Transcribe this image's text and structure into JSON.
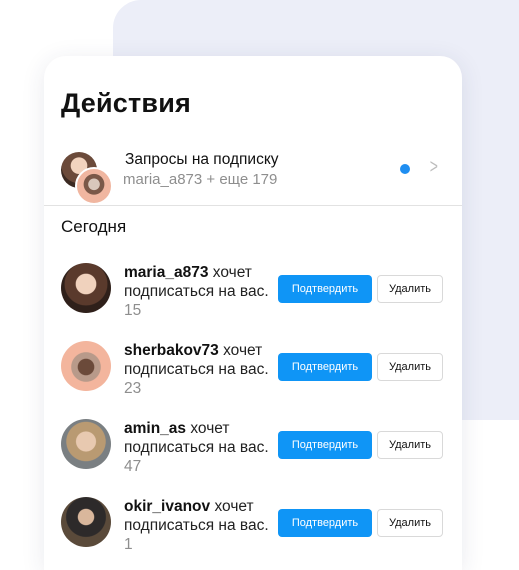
{
  "title": "Действия",
  "requests": {
    "title": "Запросы на подписку",
    "subtitle": "maria_a873 + еще 179"
  },
  "section": "Сегодня",
  "activity": [
    {
      "username": "maria_a873",
      "text": " хочет подписаться на вас.",
      "time": " 15"
    },
    {
      "username": "sherbakov73",
      "text": " хочет подписаться на вас.",
      "time": " 23"
    },
    {
      "username": "amin_as",
      "text": " хочет подписаться на вас.",
      "time": " 47"
    },
    {
      "username": "okir_ivanov",
      "text": " хочет подписаться на вас.",
      "time": " 1"
    }
  ],
  "buttons": {
    "confirm": "Подтвердить",
    "delete": "Удалить"
  },
  "colors": {
    "accent": "#0f95f6",
    "dot": "#1f8ef1",
    "muted_text": "#8e8e8e"
  }
}
